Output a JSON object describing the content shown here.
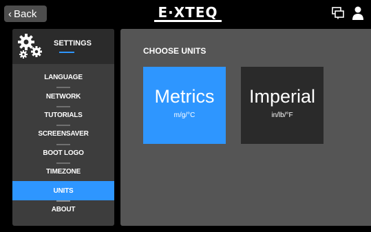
{
  "topbar": {
    "back_label": "Back",
    "logo_text": "E·XTEQ"
  },
  "sidebar": {
    "title": "SETTINGS",
    "items": [
      {
        "label": "LANGUAGE",
        "active": false
      },
      {
        "label": "NETWORK",
        "active": false
      },
      {
        "label": "TUTORIALS",
        "active": false
      },
      {
        "label": "SCREENSAVER",
        "active": false
      },
      {
        "label": "BOOT LOGO",
        "active": false
      },
      {
        "label": "TIMEZONE",
        "active": false
      },
      {
        "label": "UNITS",
        "active": true
      },
      {
        "label": "ABOUT",
        "active": false
      }
    ]
  },
  "content": {
    "title": "CHOOSE UNITS",
    "options": [
      {
        "label": "Metrics",
        "units": "m/g/°C",
        "selected": true
      },
      {
        "label": "Imperial",
        "units": "in/lb/°F",
        "selected": false
      }
    ]
  },
  "colors": {
    "accent": "#2e96ff",
    "panel": "#555555",
    "sidebar": "#3d3d3d"
  }
}
